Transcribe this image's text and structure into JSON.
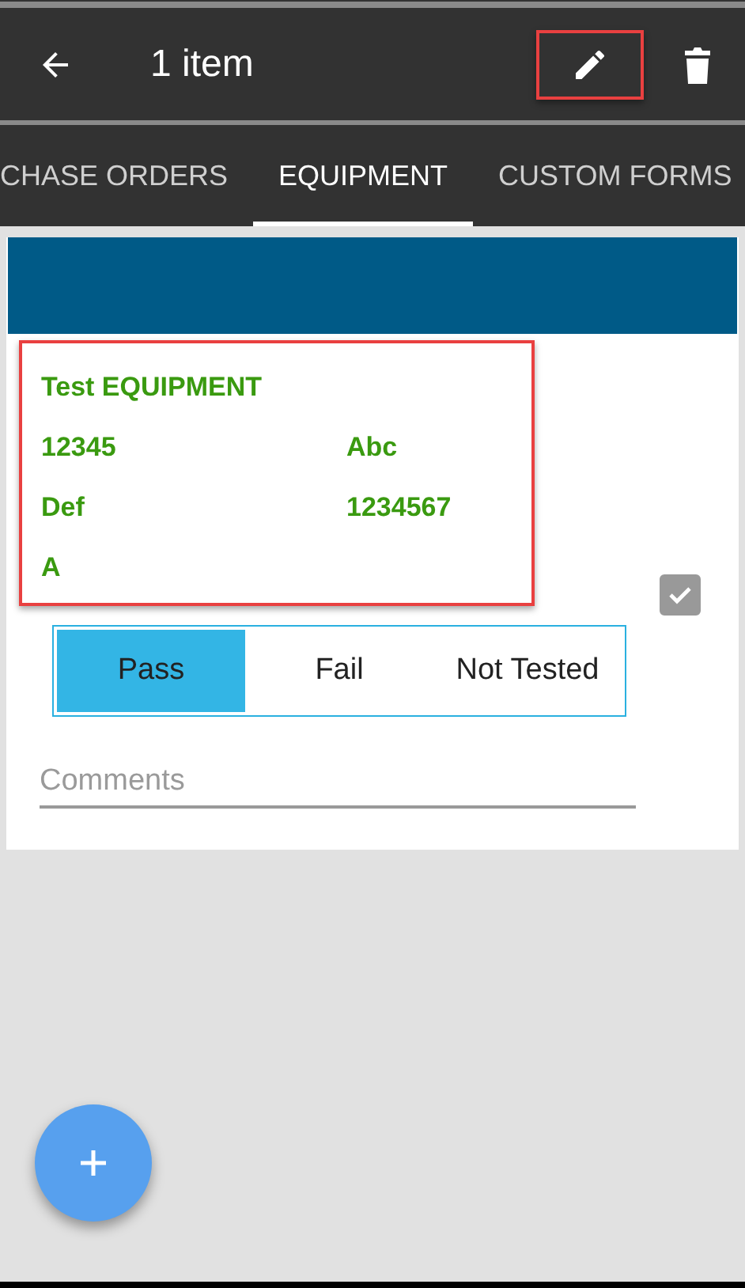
{
  "toolbar": {
    "title": "1 item",
    "edit_highlighted": true
  },
  "tabs": [
    {
      "label": "CHASE ORDERS",
      "selected": false
    },
    {
      "label": "EQUIPMENT",
      "selected": true
    },
    {
      "label": "CUSTOM FORMS",
      "selected": false
    }
  ],
  "equipment": {
    "highlighted": true,
    "name": "Test EQUIPMENT",
    "fields": [
      "12345",
      "Abc",
      "Def",
      "1234567",
      "A"
    ],
    "checked": true,
    "result_options": [
      {
        "label": "Pass",
        "selected": true
      },
      {
        "label": "Fail",
        "selected": false
      },
      {
        "label": "Not Tested",
        "selected": false
      }
    ],
    "comments": {
      "placeholder": "Comments"
    }
  }
}
